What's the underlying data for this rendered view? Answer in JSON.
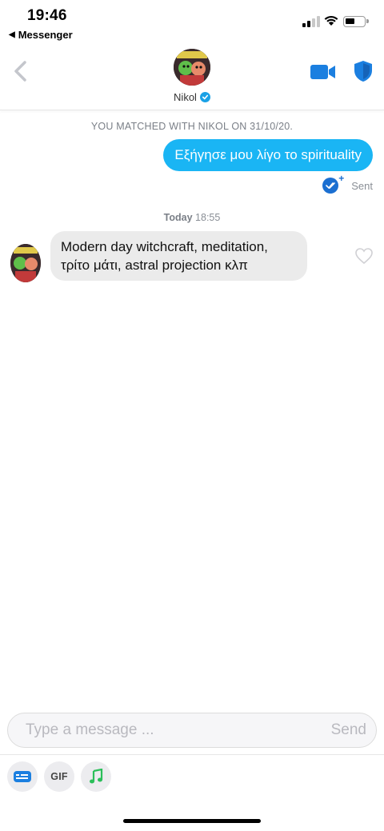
{
  "status_bar": {
    "time": "19:46",
    "back_app_label": "Messenger",
    "signal_bars": 2
  },
  "header": {
    "contact_name": "Nikol",
    "verified": true,
    "icons": [
      "back-chevron-icon",
      "video-call-icon",
      "safety-shield-icon",
      "verified-badge-icon"
    ]
  },
  "chat": {
    "match_notice": "YOU MATCHED WITH NIKOL ON 31/10/20.",
    "outgoing_message": "Εξήγησε μου λίγο το spirituality",
    "delivery_status": "Sent",
    "day_label": "Today",
    "day_time": "18:55",
    "incoming_message_lines": [
      "Modern day witchcraft, meditation,",
      "τρίτο μάτι, astral projection κλπ"
    ]
  },
  "composer": {
    "placeholder": "Type a message ...",
    "send_label": "Send",
    "tools": [
      "card-icon",
      "GIF",
      "music-note-icon"
    ],
    "gif_label": "GIF"
  },
  "colors": {
    "accent_blue": "#1ab5f4",
    "icon_blue": "#1b6fd1",
    "incoming_bubble": "#ebebeb",
    "muted_text": "#8a8f96"
  }
}
